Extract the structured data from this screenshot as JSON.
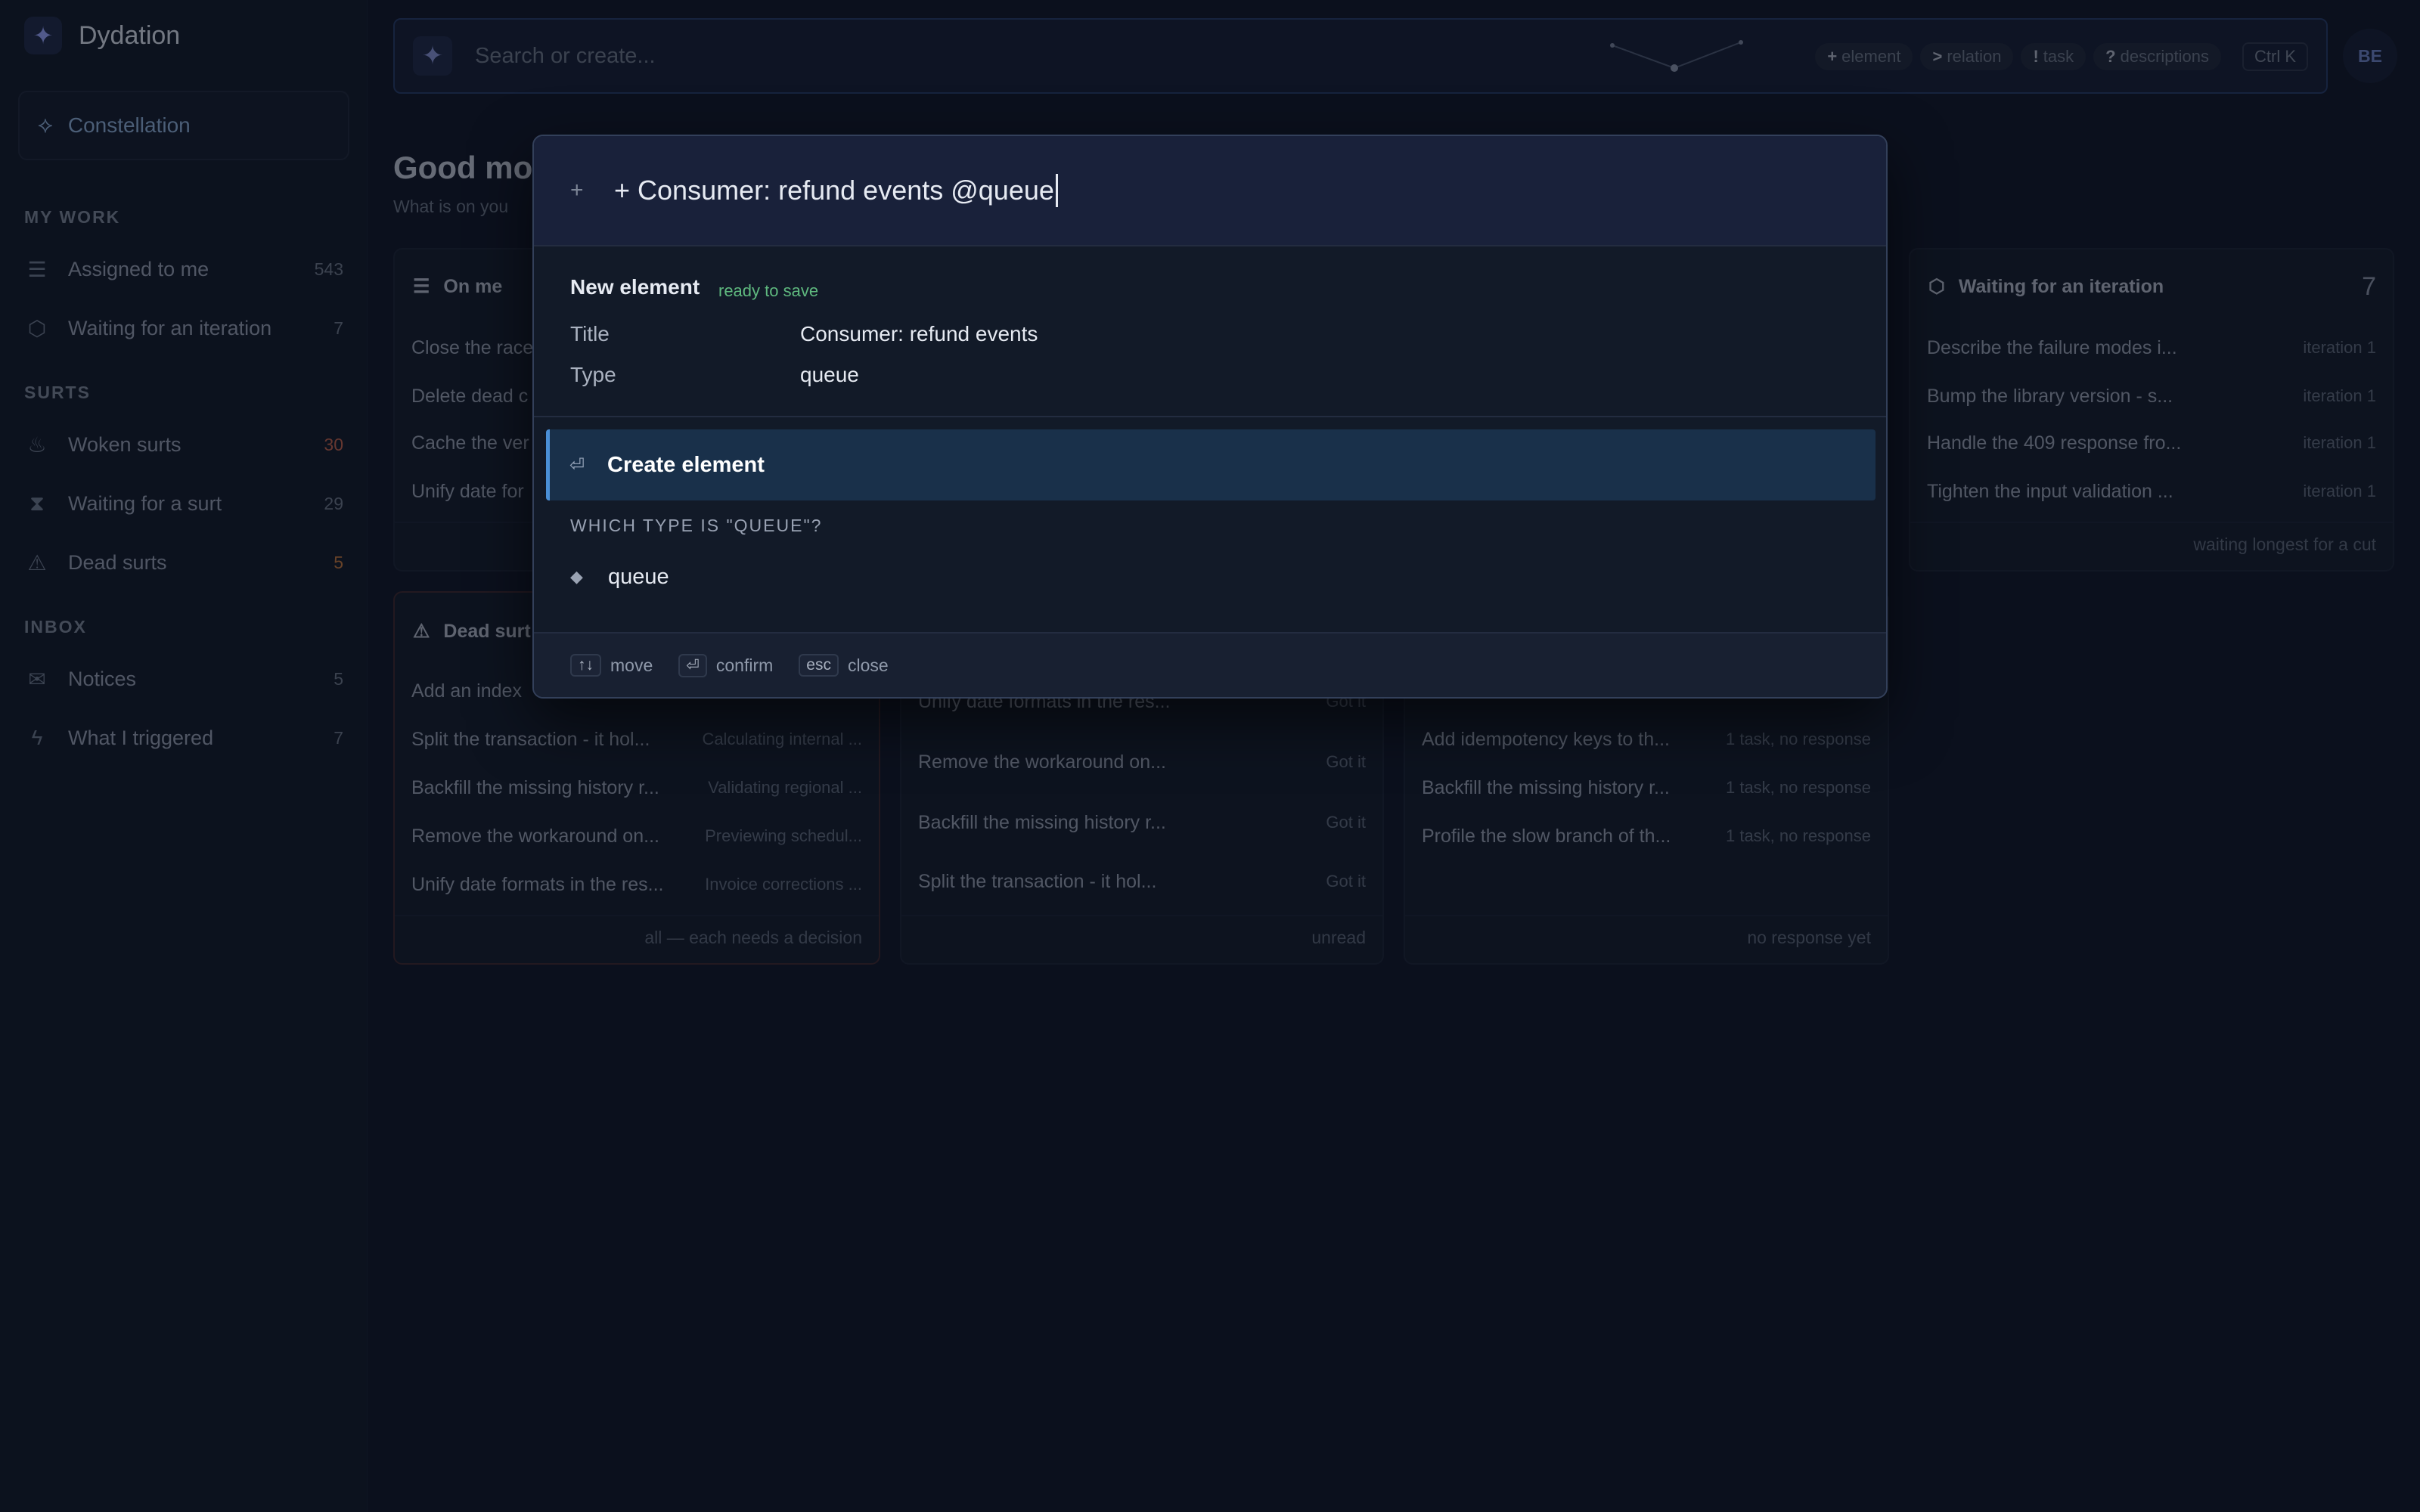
{
  "app": {
    "name": "Dydation"
  },
  "sidebar": {
    "active_item": "Constellation",
    "sections": [
      {
        "title": "MY WORK",
        "items": [
          {
            "label": "Assigned to me",
            "count": "543",
            "icon": "checklist-icon"
          },
          {
            "label": "Waiting for an iteration",
            "count": "7",
            "icon": "box-icon"
          }
        ]
      },
      {
        "title": "SURTS",
        "items": [
          {
            "label": "Woken surts",
            "count": "30",
            "icon": "flame-icon",
            "count_color": "#c5634a"
          },
          {
            "label": "Waiting for a surt",
            "count": "29",
            "icon": "hourglass-icon"
          },
          {
            "label": "Dead surts",
            "count": "5",
            "icon": "warning-icon",
            "count_color": "#c8793b"
          }
        ]
      },
      {
        "title": "INBOX",
        "items": [
          {
            "label": "Notices",
            "count": "5",
            "icon": "inbox-icon"
          },
          {
            "label": "What I triggered",
            "count": "7",
            "icon": "bolt-icon"
          }
        ]
      }
    ]
  },
  "topbar": {
    "search_placeholder": "Search or create...",
    "hints": [
      {
        "key": "+",
        "label": "element"
      },
      {
        "key": ">",
        "label": "relation"
      },
      {
        "key": "!",
        "label": "task"
      },
      {
        "key": "?",
        "label": "descriptions"
      }
    ],
    "shortcut": "Ctrl K",
    "avatar": "BE"
  },
  "greeting": {
    "title": "Good mo",
    "subtitle": "What is on you"
  },
  "cards": {
    "on_me": {
      "title": "On me",
      "rows": [
        "Close the race",
        "Delete dead c",
        "Cache the ver",
        "Unify date for"
      ]
    },
    "waiting_iteration": {
      "title": "Waiting for an iteration",
      "count": "7",
      "rows": [
        {
          "text": "Describe the failure modes i...",
          "meta": "iteration 1"
        },
        {
          "text": "Bump the library version - s...",
          "meta": "iteration 1"
        },
        {
          "text": "Handle the 409 response fro...",
          "meta": "iteration 1"
        },
        {
          "text": "Tighten the input validation ...",
          "meta": "iteration 1"
        }
      ],
      "footer": "waiting longest for a cut"
    },
    "dead_surts": {
      "title": "Dead surt",
      "rows": [
        {
          "text": "Add an index",
          "meta": ""
        },
        {
          "text": "Split the transaction - it hol...",
          "meta": "Calculating internal ..."
        },
        {
          "text": "Backfill the missing history r...",
          "meta": "Validating regional ..."
        },
        {
          "text": "Remove the workaround on...",
          "meta": "Previewing schedul..."
        },
        {
          "text": "Unify date formats in the res...",
          "meta": "Invoice corrections ..."
        }
      ],
      "footer": "all — each needs a decision"
    },
    "notices": {
      "rows": [
        {
          "text": "Unify date formats in the res...",
          "meta": "Got it"
        },
        {
          "text": "Remove the workaround on...",
          "meta": "Got it"
        },
        {
          "text": "Backfill the missing history r...",
          "meta": "Got it"
        },
        {
          "text": "Split the transaction - it hol...",
          "meta": "Got it"
        }
      ],
      "footer": "unread"
    },
    "triggered": {
      "rows": [
        {
          "text": "Add idempotency keys to th...",
          "meta": "1 task, no response"
        },
        {
          "text": "Backfill the missing history r...",
          "meta": "1 task, no response"
        },
        {
          "text": "Profile the slow branch of th...",
          "meta": "1 task, no response"
        }
      ],
      "footer": "no response yet"
    }
  },
  "modal": {
    "input_value": "+ Consumer: refund events @queue",
    "new_element_label": "New element",
    "status": "ready to save",
    "fields": [
      {
        "label": "Title",
        "value": "Consumer: refund events"
      },
      {
        "label": "Type",
        "value": "queue"
      }
    ],
    "action_label": "Create element",
    "section_title": "WHICH TYPE IS \"QUEUE\"?",
    "option_label": "queue",
    "footer_keys": [
      {
        "key": "↑↓",
        "label": "move"
      },
      {
        "key": "⏎",
        "label": "confirm"
      },
      {
        "key": "esc",
        "label": "close"
      }
    ]
  }
}
